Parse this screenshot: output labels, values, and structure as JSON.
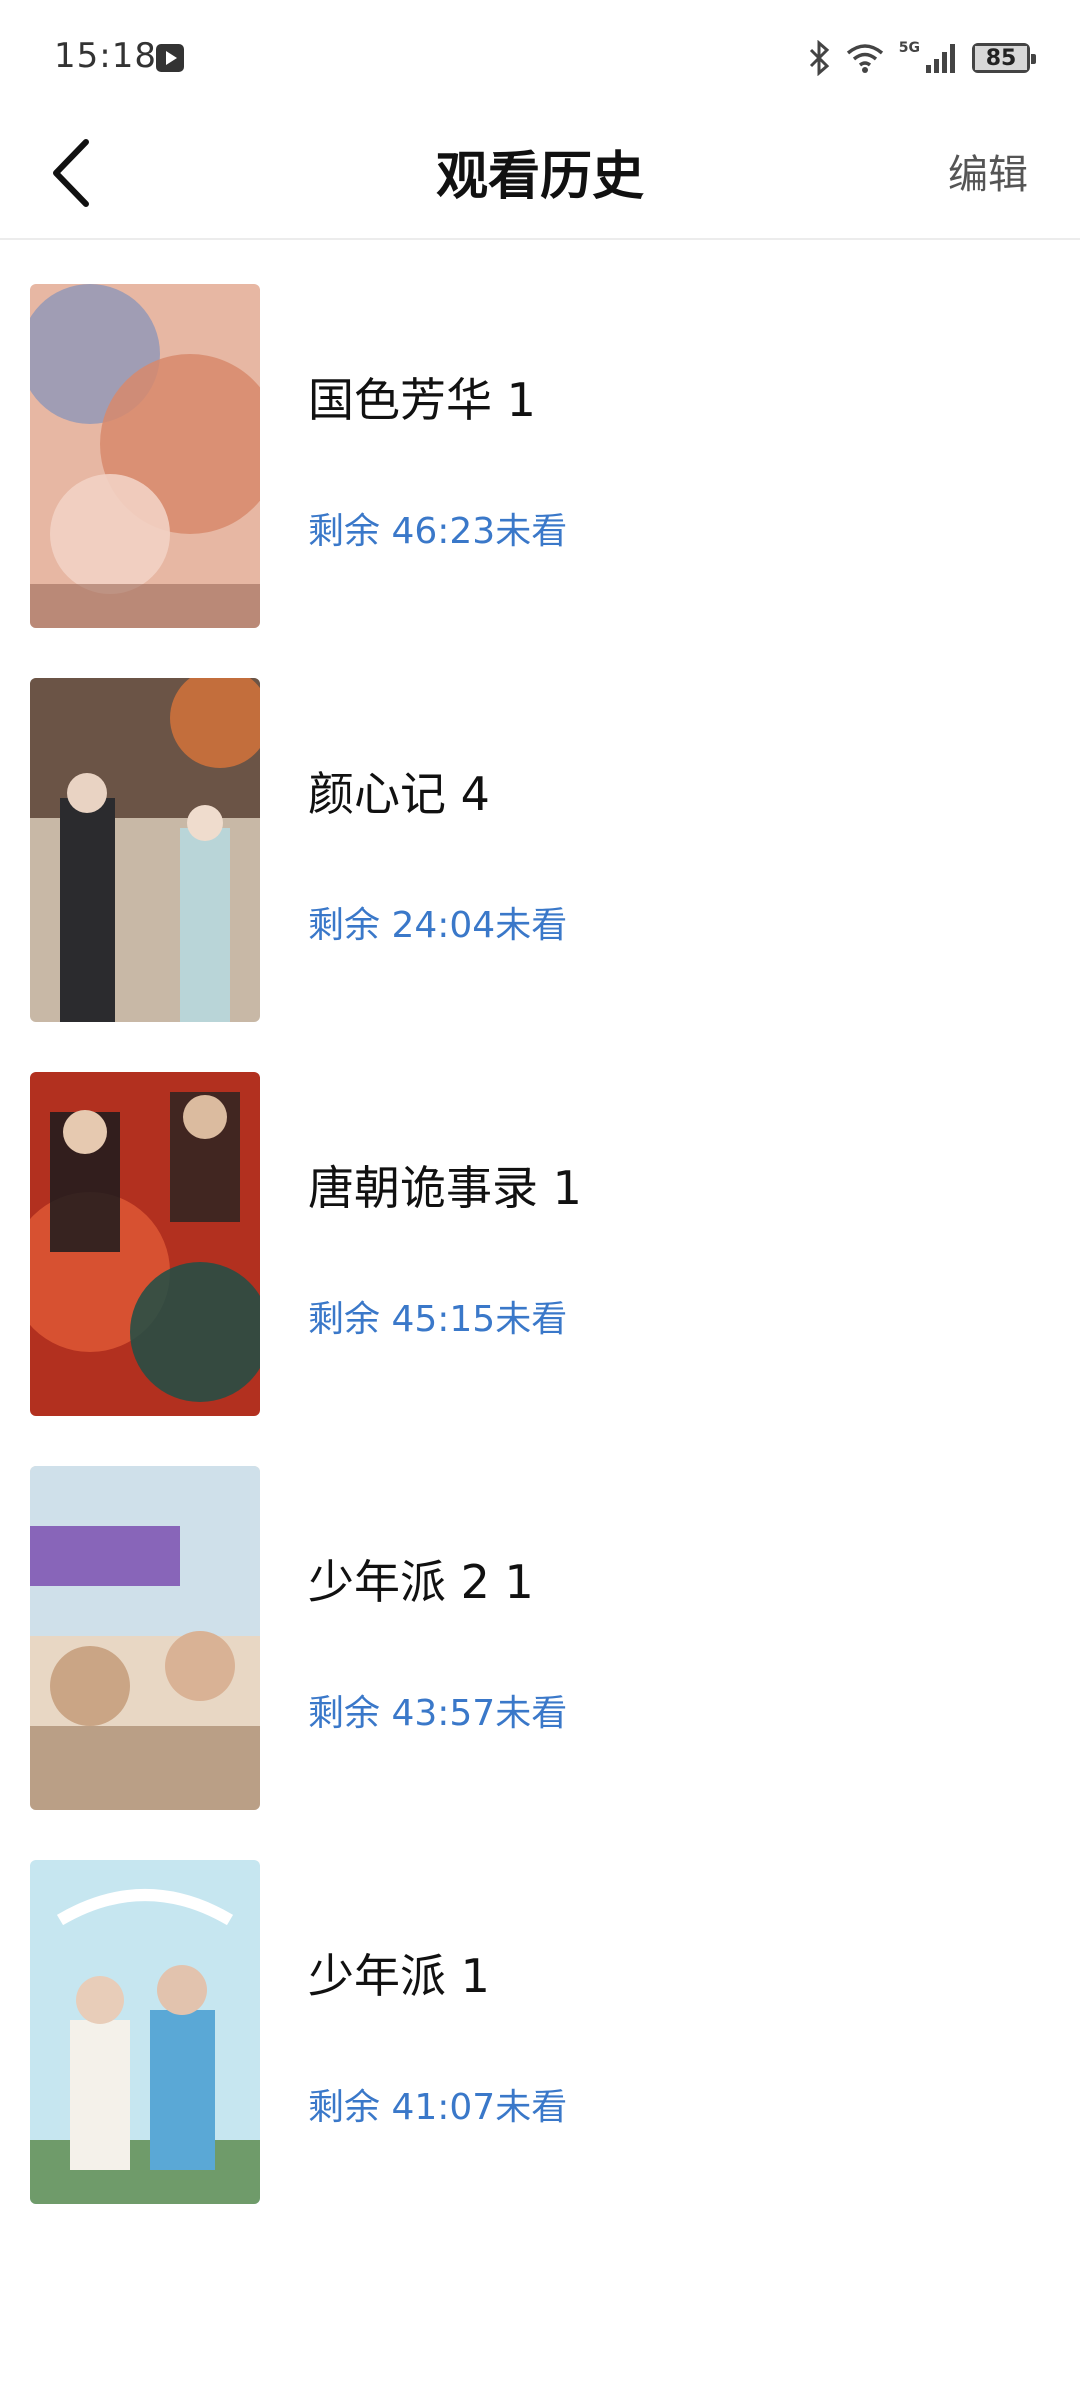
{
  "status_bar": {
    "time": "15:18",
    "network": "5G",
    "battery": "85"
  },
  "header": {
    "title": "观看历史",
    "edit_label": "编辑"
  },
  "history": [
    {
      "title": "国色芳华 1",
      "progress": "剩余 46:23未看",
      "poster_colors": [
        "#e7b7a3",
        "#8f96b8",
        "#d78a6c"
      ]
    },
    {
      "title": "颜心记 4",
      "progress": "剩余 24:04未看",
      "poster_colors": [
        "#6b5446",
        "#c8b8a6",
        "#2b2b2e"
      ]
    },
    {
      "title": "唐朝诡事录 1",
      "progress": "剩余 45:15未看",
      "poster_colors": [
        "#b2301f",
        "#1f4f47",
        "#e05a36"
      ]
    },
    {
      "title": "少年派 2 1",
      "progress": "剩余 43:57未看",
      "poster_colors": [
        "#e8d7c4",
        "#7b4fb0",
        "#caa585"
      ]
    },
    {
      "title": "少年派 1",
      "progress": "剩余 41:07未看",
      "poster_colors": [
        "#c6e6f0",
        "#5aa8d6",
        "#f4f1ea"
      ]
    }
  ]
}
